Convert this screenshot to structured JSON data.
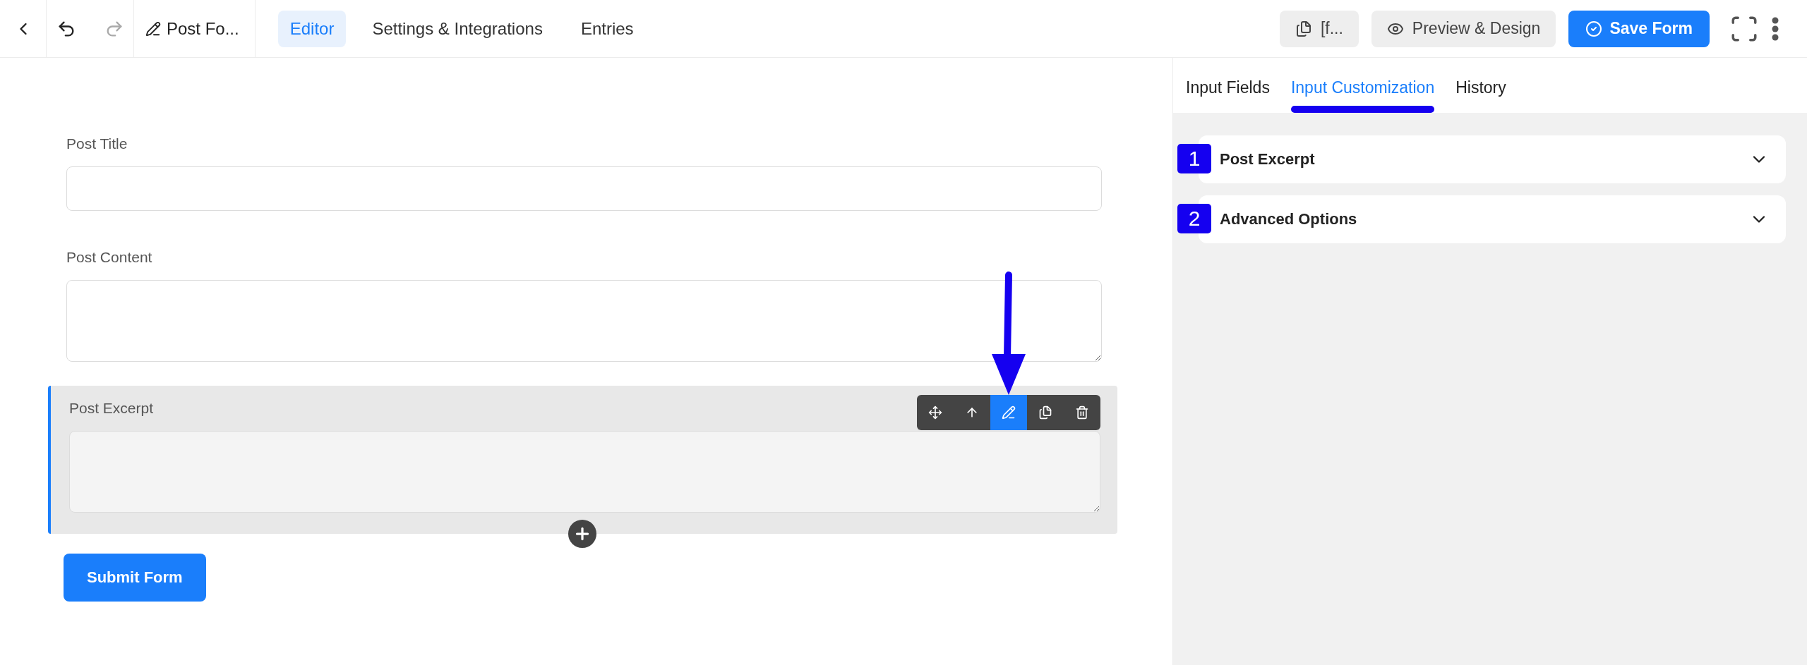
{
  "top_bar": {
    "title": "Post Fo...",
    "tabs": [
      {
        "label": "Editor",
        "selected": true
      },
      {
        "label": "Settings & Integrations",
        "selected": false
      },
      {
        "label": "Entries",
        "selected": false
      }
    ],
    "shortcode": "[f...",
    "preview": "Preview & Design",
    "save": "Save Form"
  },
  "form": {
    "fields": [
      {
        "label": "Post Title",
        "kind": "input",
        "selected": false
      },
      {
        "label": "Post Content",
        "kind": "textarea",
        "selected": false
      },
      {
        "label": "Post Excerpt",
        "kind": "textarea",
        "selected": true
      }
    ],
    "tools": [
      {
        "kind": "move",
        "selected": false
      },
      {
        "kind": "up",
        "selected": false
      },
      {
        "kind": "edit",
        "selected": true
      },
      {
        "kind": "duplicate",
        "selected": false
      },
      {
        "kind": "delete",
        "selected": false
      }
    ],
    "submit": "Submit Form"
  },
  "side_panel": {
    "tabs": [
      {
        "label": "Input Fields",
        "selected": false
      },
      {
        "label": "Input Customization",
        "selected": true
      },
      {
        "label": "History",
        "selected": false
      }
    ],
    "sections": [
      {
        "title": "Post Excerpt",
        "marker": "1",
        "expanded": false
      },
      {
        "title": "Advanced Options",
        "marker": "2",
        "expanded": false
      }
    ]
  }
}
